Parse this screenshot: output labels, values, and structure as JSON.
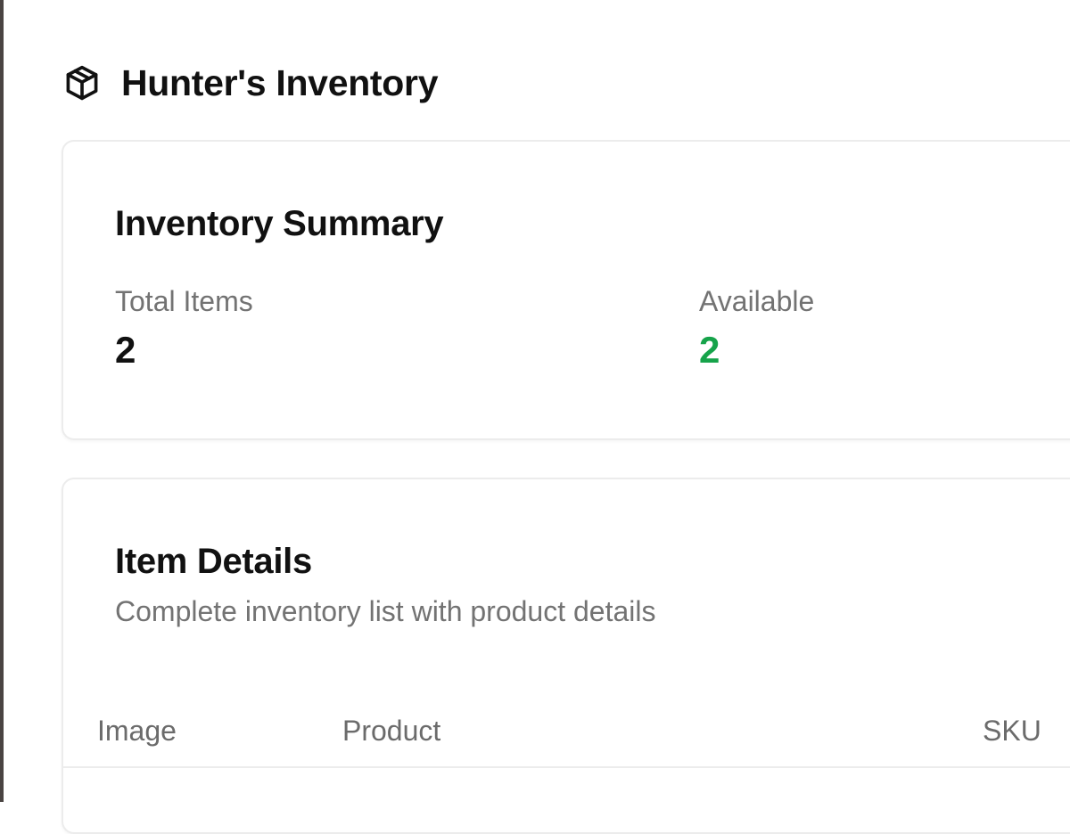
{
  "header": {
    "icon": "package-icon",
    "title": "Hunter's Inventory"
  },
  "summary": {
    "title": "Inventory Summary",
    "total_items_label": "Total Items",
    "total_items_value": "2",
    "available_label": "Available",
    "available_value": "2",
    "available_color": "#16a34a"
  },
  "details": {
    "title": "Item Details",
    "subtitle": "Complete inventory list with product details",
    "columns": [
      "Image",
      "Product",
      "SKU"
    ]
  }
}
